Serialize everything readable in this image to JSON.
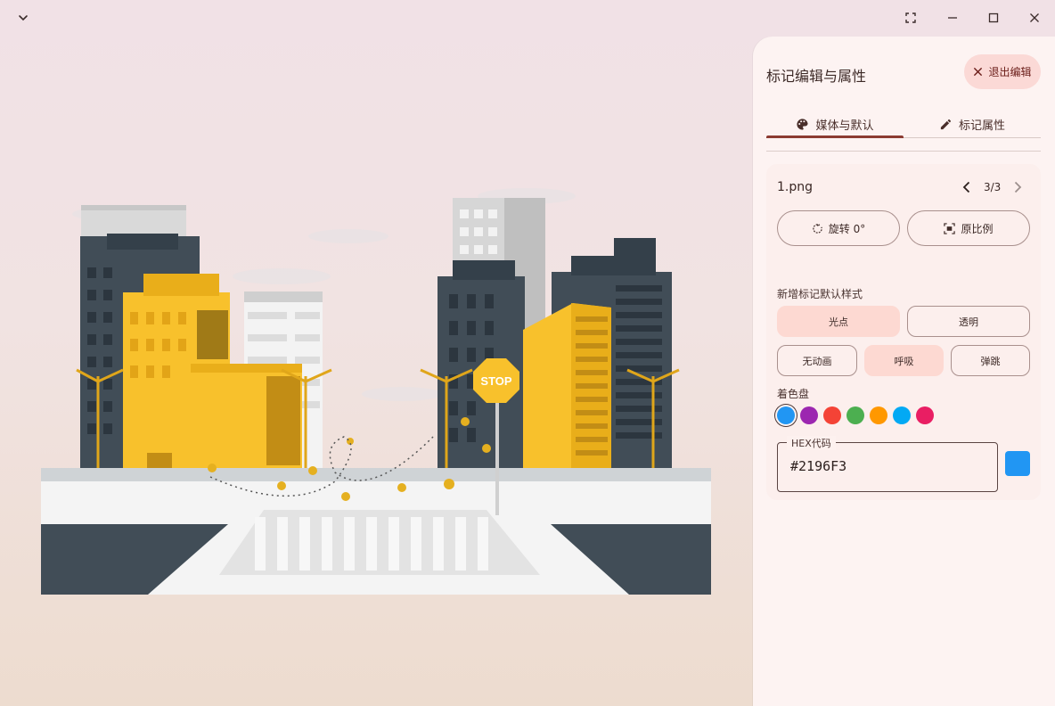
{
  "panel": {
    "title": "标记编辑与属性",
    "exit_label": "退出编辑",
    "tabs": [
      {
        "label": "媒体与默认",
        "active": true
      },
      {
        "label": "标记属性",
        "active": false
      }
    ]
  },
  "media": {
    "file_name": "1.png",
    "pager": "3/3",
    "rotate_label": "旋转 0°",
    "ratio_label": "原比例"
  },
  "marker_style": {
    "section_label": "新增标记默认样式",
    "type_options": [
      {
        "label": "光点",
        "selected": true
      },
      {
        "label": "透明",
        "selected": false
      }
    ],
    "animation_options": [
      {
        "label": "无动画",
        "selected": false
      },
      {
        "label": "呼吸",
        "selected": true
      },
      {
        "label": "弹跳",
        "selected": false
      }
    ],
    "palette_label": "着色盘",
    "swatches": [
      "#2196F3",
      "#9C27B0",
      "#F44336",
      "#4CAF50",
      "#FF9800",
      "#03A9F4",
      "#E91E63"
    ],
    "selected_swatch": 0,
    "hex_label": "HEX代码",
    "hex_value": "#2196F3"
  },
  "colors": {
    "accent": "#8c3b32",
    "selected_bg": "#fdd9d2",
    "panel_bg": "#fdf3f2"
  },
  "icons": {
    "titlebar": [
      "chevron-down-icon",
      "fullscreen-icon",
      "minimize-icon",
      "maximize-icon",
      "close-icon"
    ],
    "exit": "close-icon",
    "tab_media": "palette-icon",
    "tab_marker": "pencil-icon",
    "rotate": "rotate-icon",
    "ratio": "fit-ratio-icon"
  }
}
